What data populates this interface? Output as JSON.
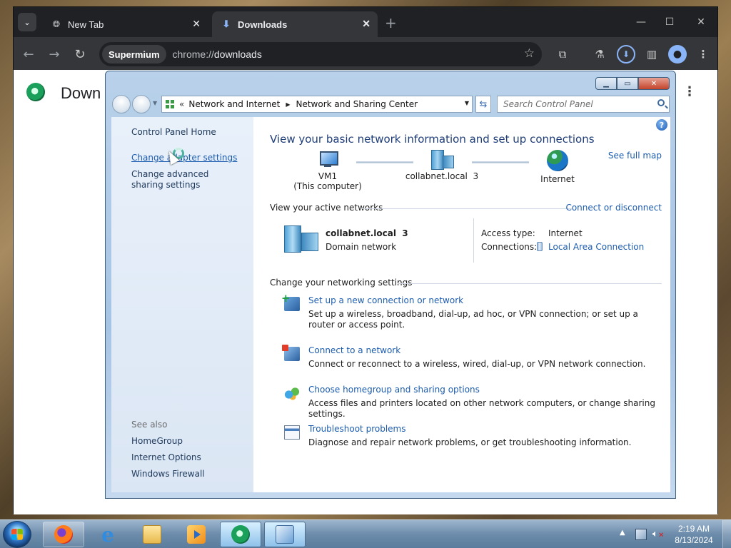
{
  "browser": {
    "tabs": [
      {
        "title": "New Tab",
        "icon": "globe-icon"
      },
      {
        "title": "Downloads",
        "icon": "download-icon"
      }
    ],
    "site_chip": "Supermium",
    "url_scheme": "chrome://",
    "url_host": "downloads",
    "page_title": "Down"
  },
  "control_panel": {
    "breadcrumb": [
      "Network and Internet",
      "Network and Sharing Center"
    ],
    "search_placeholder": "Search Control Panel",
    "sidebar": {
      "home": "Control Panel Home",
      "tasks": [
        "Change adapter settings",
        "Change advanced sharing settings"
      ],
      "see_also_heading": "See also",
      "see_also": [
        "HomeGroup",
        "Internet Options",
        "Windows Firewall"
      ]
    },
    "heading": "View your basic network information and set up connections",
    "see_full_map": "See full map",
    "map_nodes": [
      {
        "name": "VM1",
        "sub": "(This computer)",
        "icon": "computer-icon"
      },
      {
        "name": "collabnet.local  3",
        "sub": "",
        "icon": "domain-network-icon"
      },
      {
        "name": "Internet",
        "sub": "",
        "icon": "globe-icon"
      }
    ],
    "active_networks": {
      "title": "View your active networks",
      "action": "Connect or disconnect",
      "network_name": "collabnet.local  3",
      "network_type": "Domain network",
      "access_type_label": "Access type:",
      "access_type_value": "Internet",
      "connections_label": "Connections:",
      "connections_value": "Local Area Connection"
    },
    "settings": {
      "title": "Change your networking settings",
      "tasks": [
        {
          "link": "Set up a new connection or network",
          "desc": "Set up a wireless, broadband, dial-up, ad hoc, or VPN connection; or set up a router or access point.",
          "icon": "new-connection-icon"
        },
        {
          "link": "Connect to a network",
          "desc": "Connect or reconnect to a wireless, wired, dial-up, or VPN network connection.",
          "icon": "connect-network-icon"
        },
        {
          "link": "Choose homegroup and sharing options",
          "desc": "Access files and printers located on other network computers, or change sharing settings.",
          "icon": "homegroup-icon"
        },
        {
          "link": "Troubleshoot problems",
          "desc": "Diagnose and repair network problems, or get troubleshooting information.",
          "icon": "troubleshoot-icon"
        }
      ]
    }
  },
  "taskbar": {
    "time": "2:19 AM",
    "date": "8/13/2024"
  }
}
